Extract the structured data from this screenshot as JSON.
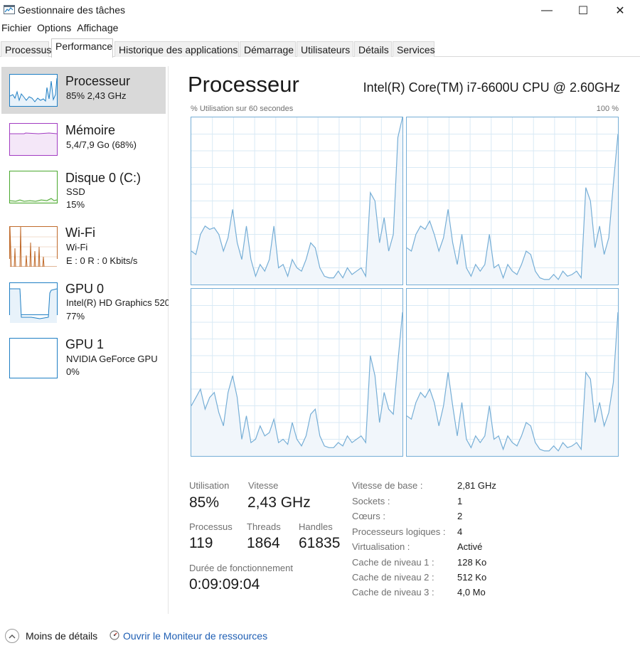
{
  "window": {
    "title": "Gestionnaire des tâches",
    "minimize": "—",
    "maximize": "☐",
    "close": "✕"
  },
  "menu": [
    "Fichier",
    "Options",
    "Affichage"
  ],
  "tabs": [
    "Processus",
    "Performance",
    "Historique des applications",
    "Démarrage",
    "Utilisateurs",
    "Détails",
    "Services"
  ],
  "active_tab": "Performance",
  "sidebar": [
    {
      "name": "Processeur",
      "sub1": "85%  2,43 GHz",
      "sub2": "",
      "color": "#1f7fc4",
      "fill": "#e8f2fa",
      "icon": "cpu-mini-graph"
    },
    {
      "name": "Mémoire",
      "sub1": "5,4/7,9 Go (68%)",
      "sub2": "",
      "color": "#a23cc2",
      "fill": "#f4e7f8",
      "icon": "memory-mini-graph"
    },
    {
      "name": "Disque 0 (C:)",
      "sub1": "SSD",
      "sub2": "15%",
      "color": "#4aa82e",
      "fill": "#eef7e9",
      "icon": "disk-mini-graph"
    },
    {
      "name": "Wi-Fi",
      "sub1": "Wi-Fi",
      "sub2": "E : 0  R : 0 Kbits/s",
      "color": "#c06b2c",
      "fill": "#f8eee5",
      "icon": "wifi-mini-graph"
    },
    {
      "name": "GPU 0",
      "sub1": "Intel(R) HD Graphics 520",
      "sub2": "77%",
      "color": "#1f7fc4",
      "fill": "#e8f2fa",
      "icon": "gpu0-mini-graph"
    },
    {
      "name": "GPU 1",
      "sub1": "NVIDIA GeForce GPU",
      "sub2": "0%",
      "color": "#1f7fc4",
      "fill": "#ffffff",
      "icon": "gpu1-mini-graph"
    }
  ],
  "main": {
    "title": "Processeur",
    "cpu_model": "Intel(R) Core(TM) i7-6600U CPU @ 2.60GHz",
    "graph_left_label": "% Utilisation sur 60 secondes",
    "graph_right_label": "100 %",
    "graph_line_color": "#76aed6",
    "graph_fill_color": "#f1f6fb",
    "graph_grid_color": "#d9eaf5"
  },
  "chart_data": {
    "type": "area",
    "title": "% Utilisation sur 60 secondes",
    "ylim": [
      0,
      100
    ],
    "x_range_seconds": 60,
    "series": [
      {
        "values": [
          20,
          18,
          30,
          35,
          33,
          34,
          30,
          20,
          28,
          45,
          25,
          15,
          35,
          15,
          5,
          12,
          8,
          15,
          35,
          10,
          12,
          5,
          15,
          10,
          8,
          15,
          25,
          22,
          10,
          5,
          4,
          4,
          8,
          4,
          10,
          6,
          8,
          10,
          5,
          55,
          50,
          25,
          40,
          20,
          30,
          88,
          100
        ]
      },
      {
        "values": [
          22,
          20,
          30,
          35,
          33,
          38,
          30,
          20,
          28,
          45,
          25,
          12,
          30,
          10,
          5,
          12,
          8,
          12,
          30,
          10,
          12,
          4,
          12,
          8,
          6,
          12,
          20,
          18,
          8,
          4,
          3,
          3,
          6,
          3,
          8,
          5,
          6,
          8,
          4,
          58,
          50,
          22,
          35,
          18,
          28,
          60,
          90
        ]
      },
      {
        "values": [
          30,
          35,
          40,
          28,
          35,
          38,
          26,
          18,
          38,
          48,
          35,
          10,
          24,
          8,
          10,
          18,
          12,
          14,
          22,
          8,
          10,
          7,
          20,
          10,
          6,
          12,
          25,
          28,
          12,
          6,
          5,
          5,
          8,
          6,
          12,
          8,
          10,
          12,
          8,
          60,
          48,
          20,
          38,
          28,
          25,
          56,
          86
        ]
      },
      {
        "values": [
          24,
          22,
          32,
          38,
          35,
          40,
          32,
          18,
          30,
          50,
          30,
          12,
          32,
          10,
          5,
          12,
          8,
          12,
          30,
          10,
          12,
          4,
          12,
          8,
          6,
          12,
          20,
          18,
          8,
          4,
          3,
          3,
          6,
          3,
          8,
          5,
          6,
          8,
          4,
          50,
          46,
          20,
          32,
          18,
          26,
          44,
          86
        ]
      }
    ]
  },
  "stats": {
    "utilisation_label": "Utilisation",
    "utilisation": "85%",
    "vitesse_label": "Vitesse",
    "vitesse": "2,43 GHz",
    "processus_label": "Processus",
    "processus": "119",
    "threads_label": "Threads",
    "threads": "1864",
    "handles_label": "Handles",
    "handles": "61835",
    "uptime_label": "Durée de fonctionnement",
    "uptime": "0:09:09:04"
  },
  "info": [
    {
      "label": "Vitesse de base :",
      "value": "2,81 GHz"
    },
    {
      "label": "Sockets :",
      "value": "1"
    },
    {
      "label": "Cœurs :",
      "value": "2"
    },
    {
      "label": "Processeurs logiques :",
      "value": "4"
    },
    {
      "label": "Virtualisation :",
      "value": "Activé"
    },
    {
      "label": "Cache de niveau 1 :",
      "value": "128 Ko"
    },
    {
      "label": "Cache de niveau 2 :",
      "value": "512 Ko"
    },
    {
      "label": "Cache de niveau 3 :",
      "value": "4,0 Mo"
    }
  ],
  "bottom": {
    "less_details": "Moins de détails",
    "resource_monitor": "Ouvrir le Moniteur de ressources",
    "less_icon": "chevron-up-icon",
    "resource_icon": "resource-monitor-icon"
  }
}
